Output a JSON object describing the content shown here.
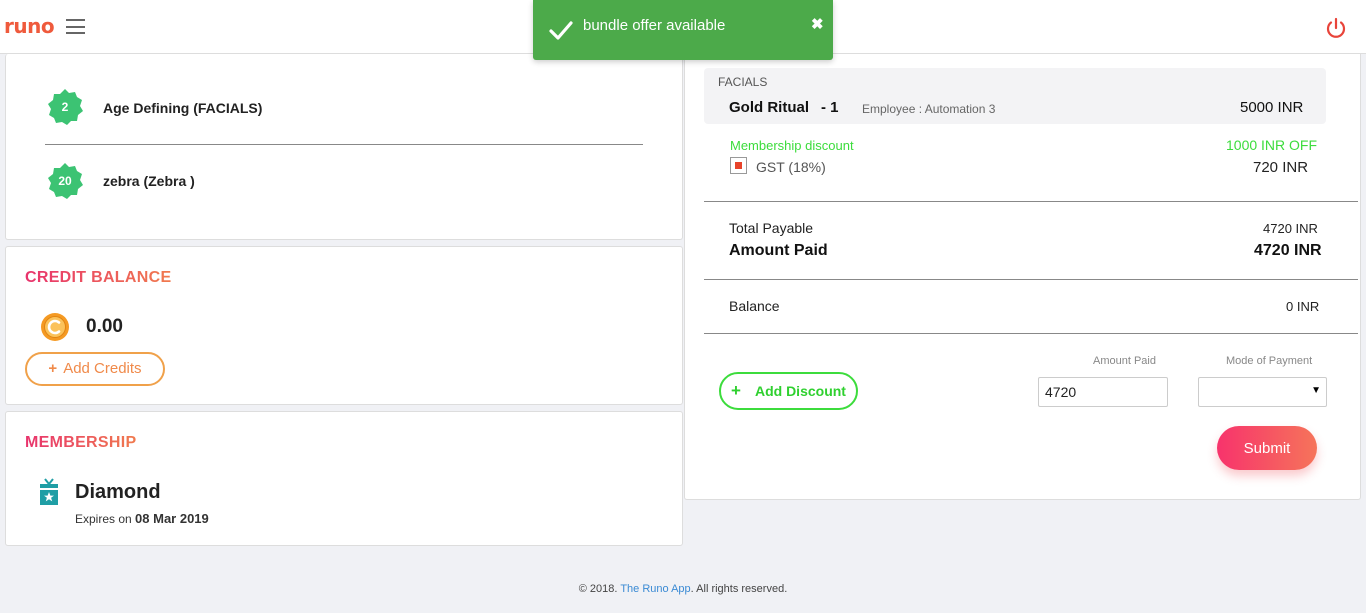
{
  "header": {
    "logo": "runo",
    "menu_icon": "hamburger-icon",
    "power_icon": "power-icon"
  },
  "toast": {
    "message": "bundle offer available",
    "close": "✖",
    "color": "#4caa4a"
  },
  "services": [
    {
      "count": "2",
      "name": "Age Defining (FACIALS)"
    },
    {
      "count": "20",
      "name": "zebra (Zebra )"
    }
  ],
  "credit": {
    "title": "CREDIT BALANCE",
    "amount": "0.00",
    "add_plus": "+",
    "add_label": "Add Credits"
  },
  "membership": {
    "title": "MEMBERSHIP",
    "name": "Diamond",
    "expires_label": "Expires on",
    "expires_date": "08 Mar 2019"
  },
  "bill": {
    "category": "FACIALS",
    "item_name": "Gold Ritual",
    "item_qty": "- 1",
    "employee": "Employee : Automation 3",
    "item_price": "5000  INR",
    "discount_label": "Membership discount",
    "discount_value": "1000 INR OFF",
    "gst_label": "GST (18%)",
    "gst_value": "720  INR",
    "total_payable_label": "Total Payable",
    "total_payable_value": "4720 INR",
    "amount_paid_label": "Amount Paid",
    "amount_paid_value": "4720 INR",
    "balance_label": "Balance",
    "balance_value": "0 INR"
  },
  "payment": {
    "add_discount_plus": "+",
    "add_discount_label": "Add Discount",
    "amount_paid_field_label": "Amount Paid",
    "amount_paid_field_value": "4720",
    "mode_label": "Mode of Payment",
    "mode_arrow": "▼",
    "submit": "Submit"
  },
  "footer": {
    "copyright": "© 2018.",
    "link": "The Runo App",
    "rights": ". All rights reserved."
  },
  "colors": {
    "accent": "#ef5a3c",
    "badge": "#3cc373",
    "discount": "#3cdc3c"
  }
}
